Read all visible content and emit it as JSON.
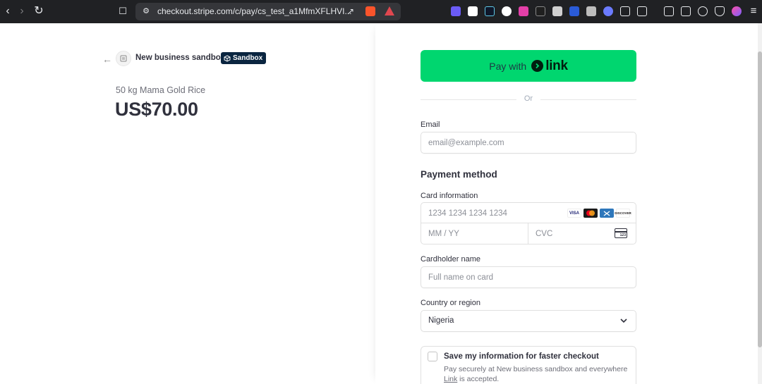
{
  "browser": {
    "url_host": "checkout.stripe.com",
    "url_path": "/c/pay/cs_test_a1MfmXFLHVI..."
  },
  "merchant": {
    "name": "New business sandbox",
    "badge": "Sandbox"
  },
  "order": {
    "product_name": "50 kg Mama Gold Rice",
    "price": "US$70.00"
  },
  "link_button": {
    "prefix": "Pay with",
    "brand": "link"
  },
  "divider": "Or",
  "email": {
    "label": "Email",
    "placeholder": "email@example.com",
    "value": ""
  },
  "payment": {
    "title": "Payment method",
    "card_label": "Card information",
    "card_number_placeholder": "1234 1234 1234 1234",
    "expiry_placeholder": "MM / YY",
    "cvc_placeholder": "CVC",
    "cvc_icon_text": "123",
    "brands": [
      "VISA",
      "mastercard",
      "amex",
      "DISCOVER"
    ]
  },
  "cardholder": {
    "label": "Cardholder name",
    "placeholder": "Full name on card"
  },
  "country": {
    "label": "Country or region",
    "value": "Nigeria"
  },
  "save_info": {
    "title": "Save my information for faster checkout",
    "description_start": "Pay securely at New business sandbox and everywhere",
    "description_link": "Link",
    "description_end": " is accepted.",
    "checked": false
  },
  "colors": {
    "link_green": "#00d66f",
    "badge_navy": "#0a2540",
    "browser_chrome": "#202124"
  }
}
